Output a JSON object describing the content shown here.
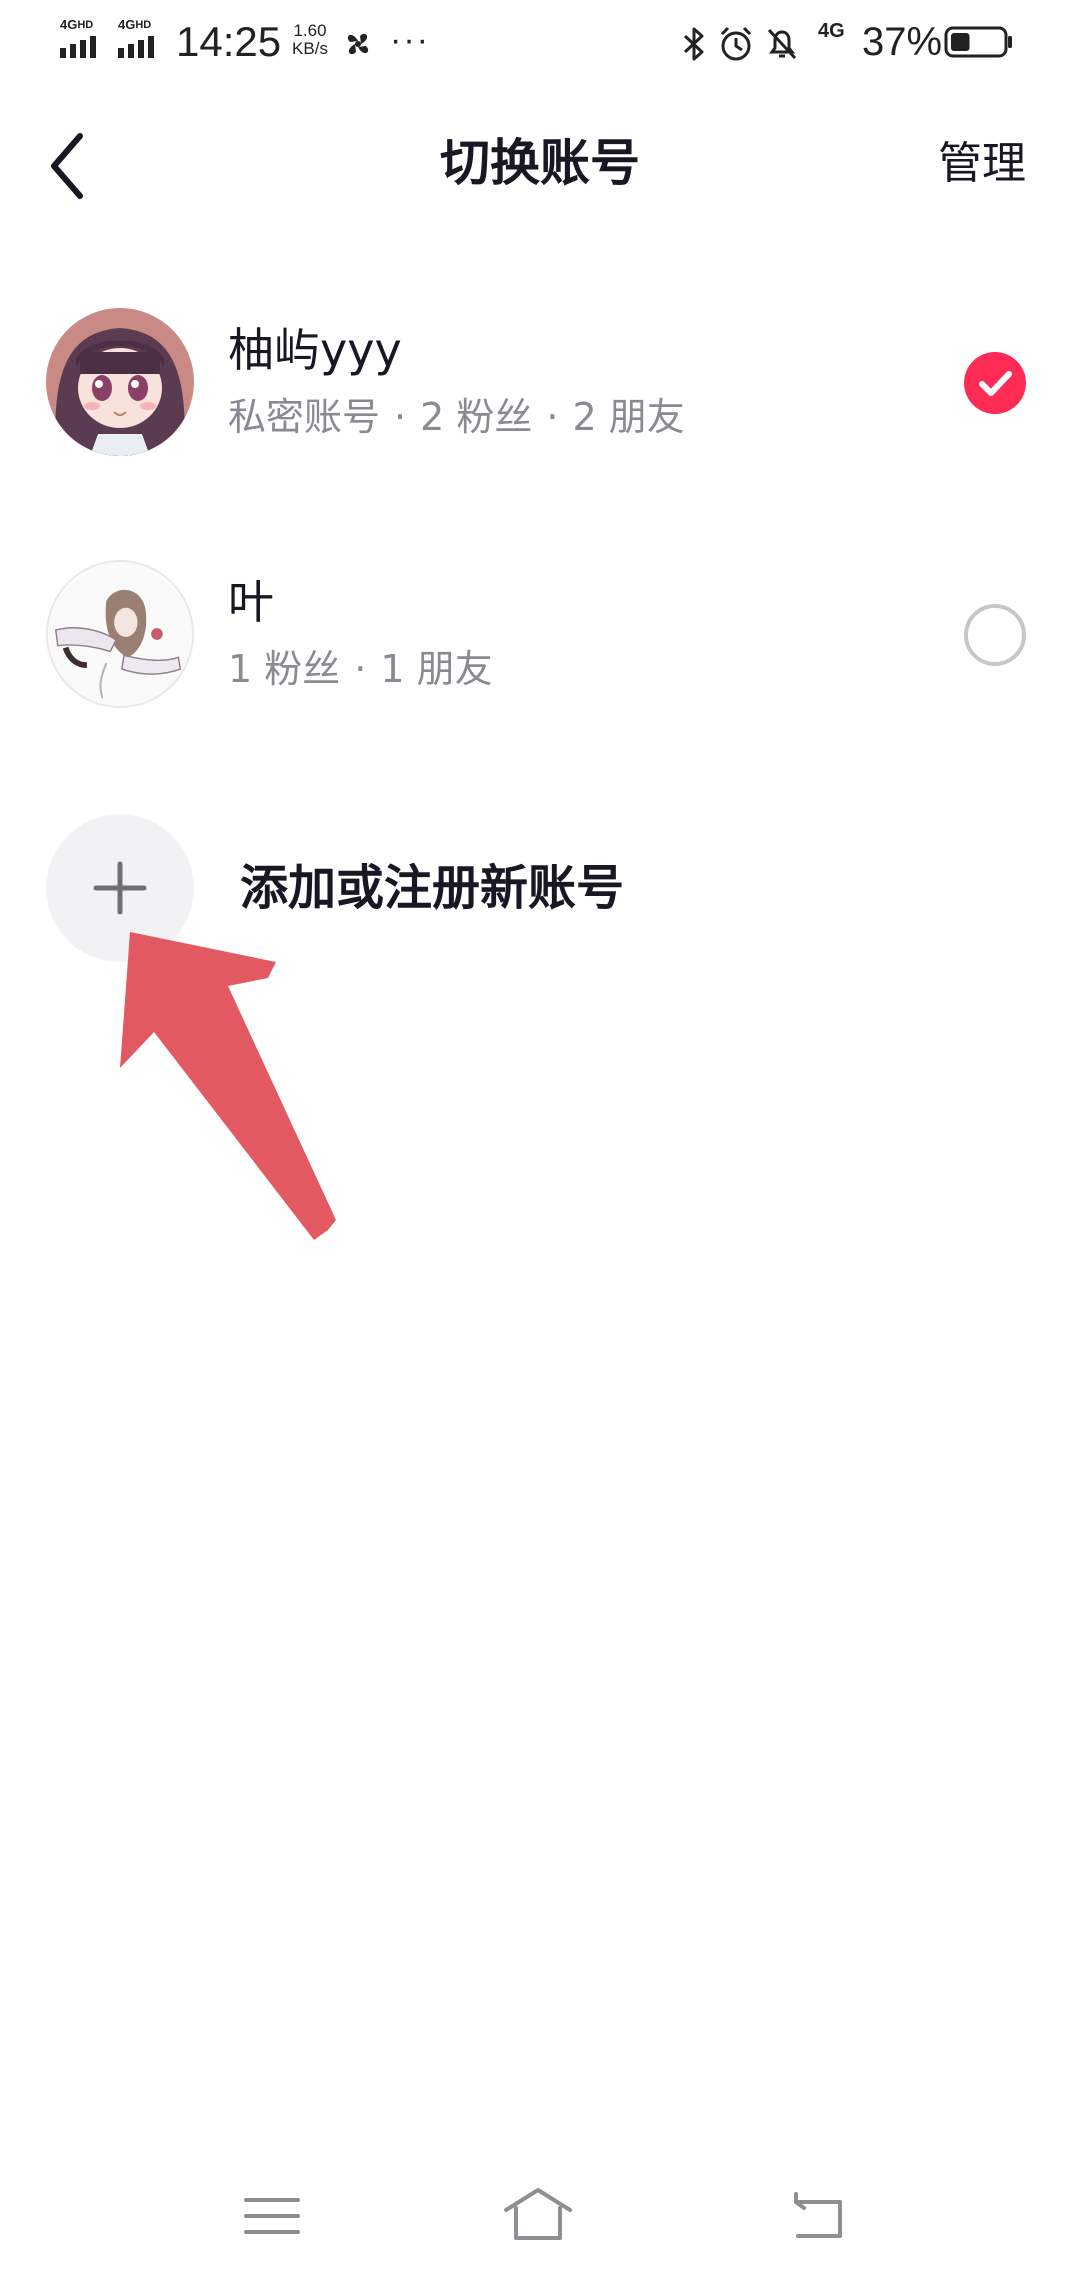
{
  "status_bar": {
    "network_1": "4G",
    "network_1_sup": "HD",
    "network_2": "4G",
    "network_2_sup": "HD",
    "time": "14:25",
    "speed_value": "1.60",
    "speed_unit": "KB/s",
    "more": "···",
    "cellular": "4G",
    "battery_percent": "37%",
    "battery_level": 0.37,
    "icons": [
      "bluetooth-icon",
      "alarm-icon",
      "mute-bell-icon"
    ]
  },
  "header": {
    "title": "切换账号",
    "manage_label": "管理"
  },
  "accounts": [
    {
      "name": "柚屿yyy",
      "meta": [
        "私密账号",
        "2 粉丝",
        "2 朋友"
      ],
      "selected": true
    },
    {
      "name": "叶",
      "meta": [
        "1 粉丝",
        "1 朋友"
      ],
      "selected": false
    }
  ],
  "add_account": {
    "label": "添加或注册新账号"
  },
  "colors": {
    "accent": "#fe2c55",
    "annotation_arrow": "#e0505a",
    "secondary_text": "#8a8b91"
  }
}
